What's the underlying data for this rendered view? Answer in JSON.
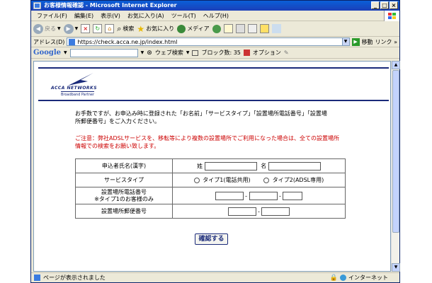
{
  "window": {
    "title": "お客様情報確認 - Microsoft Internet Explorer"
  },
  "menu": [
    "ファイル(F)",
    "編集(E)",
    "表示(V)",
    "お気に入り(A)",
    "ツール(T)",
    "ヘルプ(H)"
  ],
  "toolbar": {
    "back_label": "戻る",
    "search_label": "検索",
    "favorites_label": "お気に入り",
    "media_label": "メディア"
  },
  "address": {
    "label": "アドレス(D)",
    "url": "https://check.acca.ne.jp/index.html",
    "go_label": "移動",
    "links_label": "リンク »"
  },
  "googlebar": {
    "logo": "Google",
    "web_search_label": "ウェブ検索",
    "blocked_label": "ブロック数: 35",
    "options_label": "オプション"
  },
  "page": {
    "logo_text": "ACCA NETWORKS",
    "logo_tagline": "Broadband Partner",
    "intro": "お手数ですが、お申込み時に登録された「お名前」「サービスタイプ」「設置場所電話番号」「設置場所郵便番号」をご入力ください。",
    "notice": "ご注意：弊社ADSLサービスを、移転等により複数の設置場所でご利用になった場合は、全ての設置場所情報での検索をお願い致します。",
    "form": {
      "name_label": "申込者氏名(漢字)",
      "sei_label": "姓",
      "mei_label": "名",
      "service_label": "サービスタイプ",
      "type1_label": "タイプ1(電話共用)",
      "type2_label": "タイプ2(ADSL専用)",
      "phone_label_1": "設置場所電話番号",
      "phone_label_2": "※タイプ1のお客様のみ",
      "postal_label": "設置場所郵便番号",
      "hyphen": "-"
    },
    "confirm_label": "確認する"
  },
  "status": {
    "text": "ページが表示されました",
    "zone": "インターネット"
  }
}
